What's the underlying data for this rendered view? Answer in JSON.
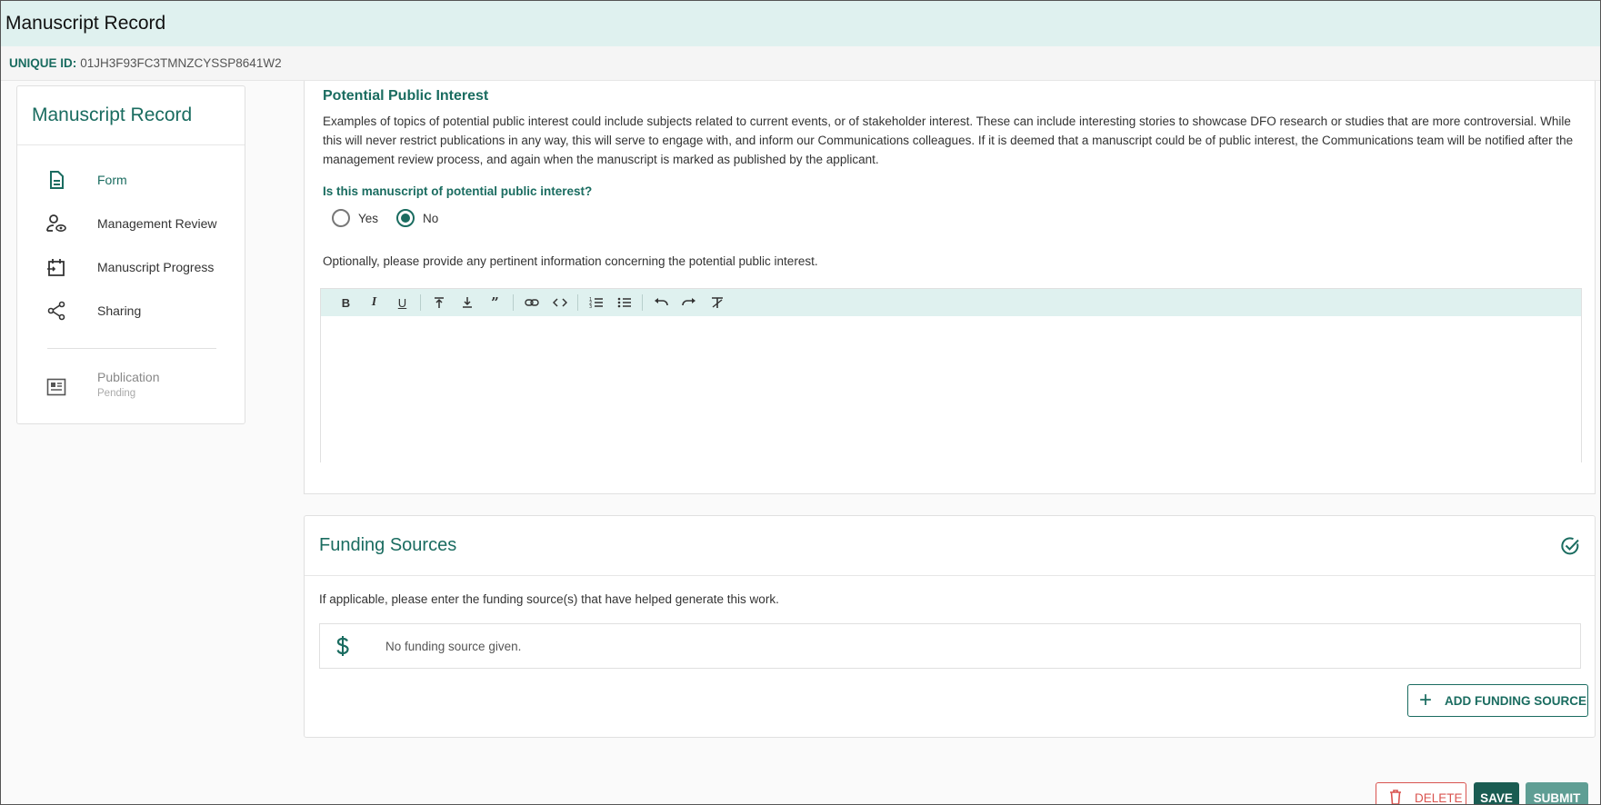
{
  "window": {
    "title": "Manuscript Record"
  },
  "idbar": {
    "label": "UNIQUE ID:",
    "value": "01JH3F93FC3TMNZCYSSP8641W2"
  },
  "sidebar": {
    "title": "Manuscript Record",
    "items": [
      {
        "label": "Form",
        "icon": "document-icon",
        "active": true
      },
      {
        "label": "Management Review",
        "icon": "user-review-icon"
      },
      {
        "label": "Manuscript Progress",
        "icon": "calendar-progress-icon"
      },
      {
        "label": "Sharing",
        "icon": "share-icon"
      },
      {
        "label": "Publication",
        "sub": "Pending",
        "icon": "newspaper-icon",
        "disabled": true
      }
    ]
  },
  "public_interest": {
    "title": "Potential Public Interest",
    "description": "Examples of topics of potential public interest could include subjects related to current events, or of stakeholder interest. These can include interesting stories to showcase DFO research or studies that are more controversial. While this will never restrict publications in any way, this will serve to engage with, and inform our Communications colleagues. If it is deemed that a manuscript could be of public interest, the Communications team will be notified after the management review process, and again when the manuscript is marked as published by the applicant.",
    "question": "Is this manuscript of potential public interest?",
    "options": [
      "Yes",
      "No"
    ],
    "selected": "No",
    "optional_text": "Optionally, please provide any pertinent information concerning the potential public interest.",
    "toolbar": [
      "bold",
      "italic",
      "underline",
      "superscript",
      "subscript",
      "blockquote",
      "link",
      "code",
      "ordered-list",
      "bullet-list",
      "undo",
      "redo",
      "clear-format"
    ]
  },
  "funding": {
    "title": "Funding Sources",
    "description": "If applicable, please enter the funding source(s) that have helped generate this work.",
    "empty_text": "No funding source given.",
    "add_label": "ADD FUNDING SOURCE"
  },
  "actions": {
    "delete_label": "DELETE",
    "save_label": "SAVE",
    "submit_label": "SUBMIT"
  },
  "colors": {
    "accent": "#1a6c60",
    "header_bg": "#dff1ef",
    "danger": "#d9534f"
  }
}
